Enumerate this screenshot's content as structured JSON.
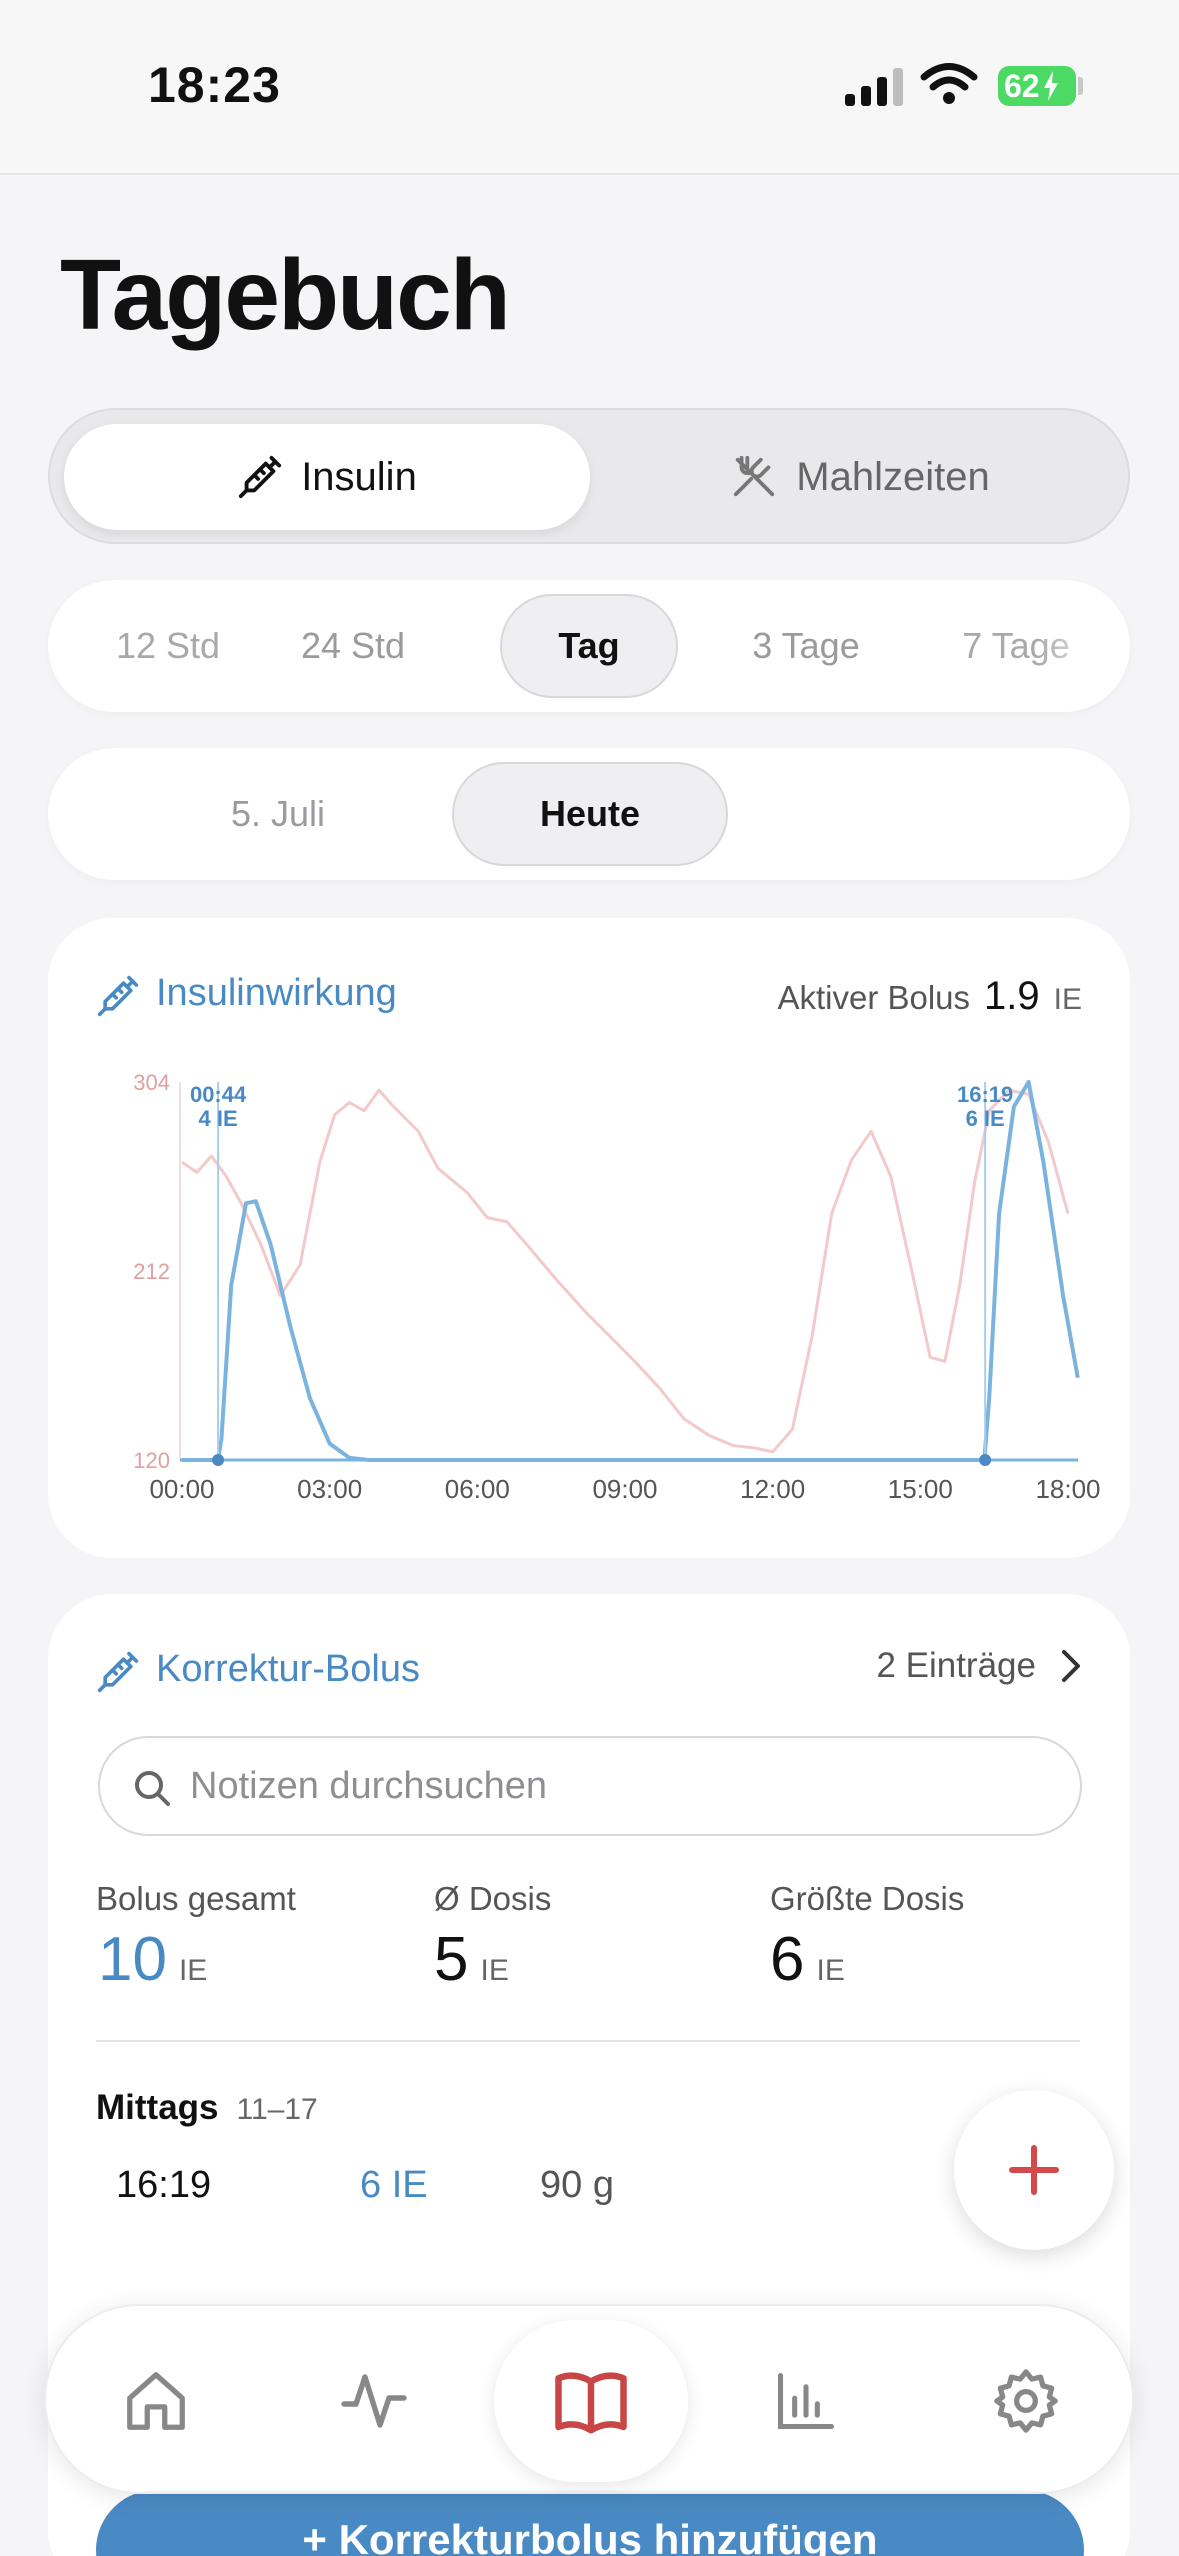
{
  "status": {
    "time": "18:23",
    "battery": "62"
  },
  "page_title": "Tagebuch",
  "segments": [
    {
      "label": "Insulin",
      "icon": "syringe-icon",
      "active": true
    },
    {
      "label": "Mahlzeiten",
      "icon": "fork-knife-icon",
      "active": false
    }
  ],
  "ranges": [
    "12 Std",
    "24 Std",
    "Tag",
    "3 Tage",
    "7 Tage"
  ],
  "dates": [
    "5. Juli",
    "Heute"
  ],
  "insulin_card": {
    "title": "Insulinwirkung",
    "active_bolus_label": "Aktiver Bolus",
    "active_bolus_value": "1.9",
    "active_bolus_unit": "IE"
  },
  "chart_data": {
    "type": "line",
    "x_ticks": [
      "00:00",
      "03:00",
      "06:00",
      "09:00",
      "12:00",
      "15:00",
      "18:00"
    ],
    "y_ticks": [
      304,
      212,
      120
    ],
    "annotations": [
      {
        "time": "00:44",
        "dose": "4 IE"
      },
      {
        "time": "16:19",
        "dose": "6 IE"
      }
    ],
    "series": [
      {
        "color": "#f3c9c9",
        "points": [
          [
            0.0,
            265
          ],
          [
            0.3,
            260
          ],
          [
            0.6,
            268
          ],
          [
            0.9,
            258
          ],
          [
            1.2,
            245
          ],
          [
            1.6,
            225
          ],
          [
            2.0,
            200
          ],
          [
            2.4,
            215
          ],
          [
            2.8,
            265
          ],
          [
            3.1,
            288
          ],
          [
            3.4,
            294
          ],
          [
            3.7,
            290
          ],
          [
            4.0,
            300
          ],
          [
            4.3,
            292
          ],
          [
            4.8,
            280
          ],
          [
            5.2,
            262
          ],
          [
            5.8,
            250
          ],
          [
            6.2,
            238
          ],
          [
            6.6,
            236
          ],
          [
            7.0,
            225
          ],
          [
            7.6,
            208
          ],
          [
            8.2,
            192
          ],
          [
            8.7,
            180
          ],
          [
            9.2,
            168
          ],
          [
            9.7,
            155
          ],
          [
            10.2,
            140
          ],
          [
            10.7,
            132
          ],
          [
            11.2,
            127
          ],
          [
            11.6,
            126
          ],
          [
            12.0,
            124
          ],
          [
            12.4,
            135
          ],
          [
            12.8,
            180
          ],
          [
            13.2,
            240
          ],
          [
            13.6,
            266
          ],
          [
            14.0,
            280
          ],
          [
            14.4,
            258
          ],
          [
            14.8,
            215
          ],
          [
            15.2,
            170
          ],
          [
            15.5,
            168
          ],
          [
            15.8,
            205
          ],
          [
            16.1,
            255
          ],
          [
            16.4,
            290
          ],
          [
            16.8,
            300
          ],
          [
            17.2,
            298
          ],
          [
            17.6,
            275
          ],
          [
            18.0,
            240
          ]
        ]
      },
      {
        "color": "#7ab3dd",
        "points": [
          [
            0.0,
            120
          ],
          [
            0.73,
            120
          ],
          [
            0.8,
            130
          ],
          [
            1.0,
            205
          ],
          [
            1.3,
            245
          ],
          [
            1.5,
            246
          ],
          [
            1.8,
            225
          ],
          [
            2.2,
            185
          ],
          [
            2.6,
            150
          ],
          [
            3.0,
            128
          ],
          [
            3.4,
            121
          ],
          [
            3.8,
            120
          ],
          [
            16.3,
            120
          ],
          [
            16.4,
            150
          ],
          [
            16.6,
            240
          ],
          [
            16.9,
            292
          ],
          [
            17.2,
            304
          ],
          [
            17.5,
            265
          ],
          [
            17.9,
            200
          ],
          [
            18.2,
            160
          ]
        ]
      }
    ]
  },
  "bolus_card": {
    "title": "Korrektur-Bolus",
    "entries": "2 Einträge",
    "search_placeholder": "Notizen durchsuchen",
    "stats": [
      {
        "label": "Bolus gesamt",
        "value": "10",
        "unit": "IE"
      },
      {
        "label": "Ø Dosis",
        "value": "5",
        "unit": "IE"
      },
      {
        "label": "Größte Dosis",
        "value": "6",
        "unit": "IE"
      }
    ],
    "group": {
      "name": "Mittags",
      "range": "11–17"
    },
    "row": {
      "time": "16:19",
      "dose": "6 IE",
      "carbs": "90 g"
    }
  },
  "cta_label": "+ Korrekturbolus hinzufügen"
}
